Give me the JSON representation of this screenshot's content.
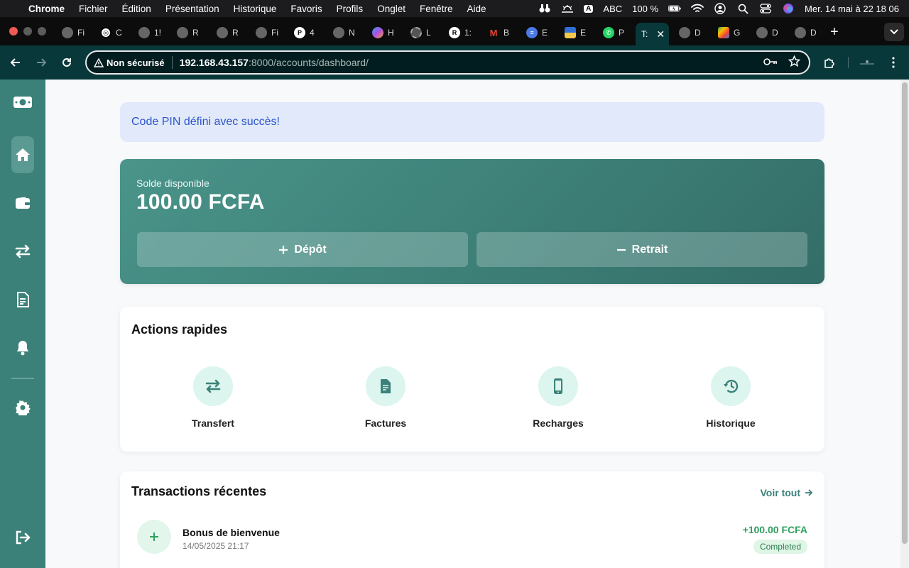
{
  "menubar": {
    "app_name": "Chrome",
    "menus": [
      "Fichier",
      "Édition",
      "Présentation",
      "Historique",
      "Favoris",
      "Profils",
      "Onglet",
      "Fenêtre",
      "Aide"
    ],
    "input_source": "ABC",
    "battery": "100 %",
    "datetime": "Mer. 14 mai à  22 18 06"
  },
  "tabs": [
    {
      "label": "Fi",
      "icon": "globe-icon"
    },
    {
      "label": "C",
      "icon": "openai-icon"
    },
    {
      "label": "1!",
      "icon": "globe-icon"
    },
    {
      "label": "R",
      "icon": "globe-icon"
    },
    {
      "label": "R",
      "icon": "globe-icon"
    },
    {
      "label": "Fi",
      "icon": "globe-icon"
    },
    {
      "label": "4",
      "icon": "p-icon"
    },
    {
      "label": "N",
      "icon": "globe-icon"
    },
    {
      "label": "H",
      "icon": "copilot-icon"
    },
    {
      "label": "L",
      "icon": "globe-icon"
    },
    {
      "label": "1:",
      "icon": "r-icon"
    },
    {
      "label": "B",
      "icon": "gmail-icon"
    },
    {
      "label": "E",
      "icon": "docs-icon"
    },
    {
      "label": "E",
      "icon": "flag-icon"
    },
    {
      "label": "P",
      "icon": "whatsapp-icon"
    },
    {
      "label": "T:",
      "icon": "",
      "active": true
    },
    {
      "label": "D",
      "icon": "globe-icon"
    },
    {
      "label": "G",
      "icon": "meet-icon"
    },
    {
      "label": "D",
      "icon": "globe-icon"
    },
    {
      "label": "D",
      "icon": "globe-icon"
    }
  ],
  "address_bar": {
    "security_label": "Non sécurisé",
    "host": "192.168.43.157",
    "path": ":8000/accounts/dashboard/"
  },
  "sidebar": {
    "items": [
      {
        "name": "money-icon"
      },
      {
        "name": "home-icon",
        "active": true
      },
      {
        "name": "wallet-icon"
      },
      {
        "name": "transfer-icon"
      },
      {
        "name": "invoice-icon"
      },
      {
        "name": "bell-icon"
      },
      {
        "name": "gear-icon"
      },
      {
        "name": "logout-icon"
      }
    ]
  },
  "alert": {
    "message": "Code PIN défini avec succès!"
  },
  "balance": {
    "label": "Solde disponible",
    "amount": "100.00 FCFA",
    "deposit_label": "Dépôt",
    "withdraw_label": "Retrait"
  },
  "quick_actions": {
    "title": "Actions rapides",
    "items": [
      {
        "label": "Transfert",
        "icon": "transfer-icon"
      },
      {
        "label": "Factures",
        "icon": "invoice-icon"
      },
      {
        "label": "Recharges",
        "icon": "mobile-icon"
      },
      {
        "label": "Historique",
        "icon": "history-icon"
      }
    ]
  },
  "transactions": {
    "title": "Transactions récentes",
    "see_all": "Voir tout",
    "rows": [
      {
        "title": "Bonus de bienvenue",
        "date": "14/05/2025 21:17",
        "amount": "+100.00 FCFA",
        "status": "Completed"
      }
    ]
  },
  "colors": {
    "sidebar": "#3b8179",
    "accent": "#3b8179",
    "browser_toolbar": "#08383a",
    "alert_bg": "#e1e9fb",
    "alert_text": "#2c55c9",
    "success": "#2f9f5f"
  }
}
